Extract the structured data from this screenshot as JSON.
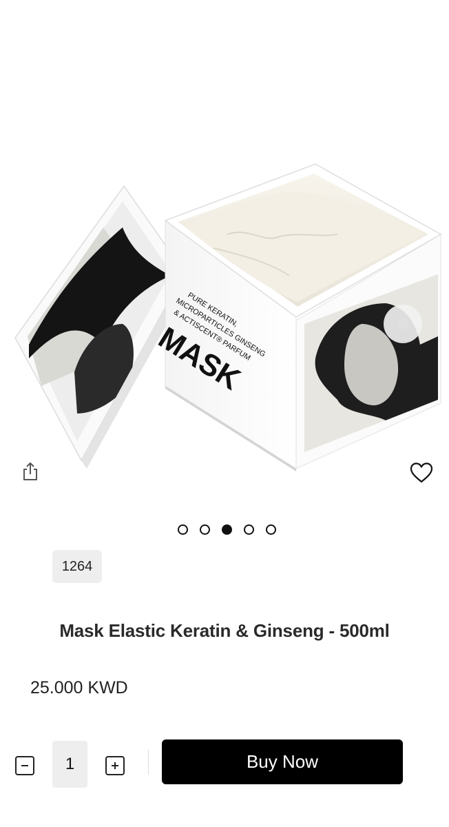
{
  "gallery": {
    "image_alt": "Mask Elastic Keratin & Ginseng jar",
    "box_text": {
      "line1": "PURE KERATIN,",
      "line2": "MICROPARTICLES GINSENG",
      "line3": "& ACTISCENT® PARFUM",
      "brand": "MASK"
    },
    "dots_count": 5,
    "active_dot": 2
  },
  "product": {
    "sku": "1264",
    "title": "Mask Elastic Keratin & Ginseng - 500ml",
    "price": "25.000 KWD"
  },
  "cart": {
    "quantity": "1",
    "buy_label": "Buy Now"
  },
  "icons": {
    "share": "share-icon",
    "favorite": "heart-icon",
    "minus": "minus-icon",
    "plus": "plus-icon"
  }
}
